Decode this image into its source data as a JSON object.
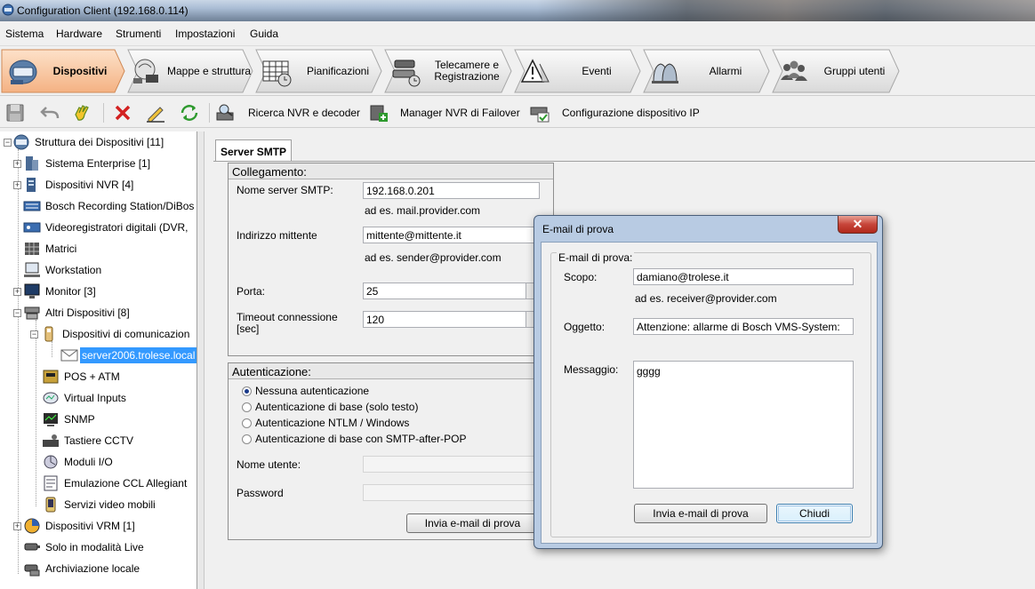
{
  "window": {
    "title": "Configuration Client (192.168.0.114)"
  },
  "menu": [
    "Sistema",
    "Hardware",
    "Strumenti",
    "Impostazioni",
    "Guida"
  ],
  "nav_tabs": [
    {
      "label": "Dispositivi",
      "icon": "devices-icon",
      "active": true
    },
    {
      "label": "Mappe e struttura",
      "icon": "maps-structure-icon",
      "active": false
    },
    {
      "label": "Pianificazioni",
      "icon": "schedules-icon",
      "active": false
    },
    {
      "label": "Telecamere e\nRegistrazione",
      "icon": "cameras-recording-icon",
      "active": false
    },
    {
      "label": "Eventi",
      "icon": "events-icon",
      "active": false
    },
    {
      "label": "Allarmi",
      "icon": "alarms-icon",
      "active": false
    },
    {
      "label": "Gruppi utenti",
      "icon": "user-groups-icon",
      "active": false
    }
  ],
  "toolbar": {
    "scan_nvr": "Ricerca NVR e decoder",
    "failover": "Manager NVR di Failover",
    "ip_config": "Configurazione dispositivo IP"
  },
  "tree": {
    "root": "Struttura dei Dispositivi [11]",
    "items": [
      "Sistema Enterprise [1]",
      "Dispositivi NVR [4]",
      "Bosch Recording Station/DiBos",
      "Videoregistratori digitali (DVR,",
      "Matrici",
      "Workstation",
      "Monitor [3]",
      "Altri Dispositivi [8]",
      "Dispositivi di comunicazion",
      "server2006.trolese.local",
      "POS + ATM",
      "Virtual Inputs",
      "SNMP",
      "Tastiere CCTV",
      "Moduli I/O",
      "Emulazione CCL Allegiant",
      "Servizi video mobili",
      "Dispositivi VRM [1]",
      "Solo in modalità Live",
      "Archiviazione locale"
    ]
  },
  "smtp": {
    "tab": "Server SMTP",
    "connection_title": "Collegamento:",
    "server_label": "Nome server SMTP:",
    "server_value": "192.168.0.201",
    "server_hint": "ad es. mail.provider.com",
    "sender_label": "Indirizzo mittente",
    "sender_value": "mittente@mittente.it",
    "sender_hint": "ad es. sender@provider.com",
    "port_label": "Porta:",
    "port_value": "25",
    "timeout_label": "Timeout connessione\n[sec]",
    "timeout_value": "120",
    "auth_title": "Autenticazione:",
    "auth_options": [
      "Nessuna autenticazione",
      "Autenticazione di base (solo testo)",
      "Autenticazione NTLM / Windows",
      "Autenticazione di base con SMTP-after-POP"
    ],
    "auth_selected": 0,
    "user_label": "Nome utente:",
    "password_label": "Password",
    "test_button": "Invia e-mail di prova"
  },
  "dialog": {
    "title": "E-mail di prova",
    "close": "✕",
    "group_label": "E-mail di prova:",
    "to_label": "Scopo:",
    "to_value": "damiano@trolese.it",
    "to_hint": "ad es. receiver@provider.com",
    "subject_label": "Oggetto:",
    "subject_value": "Attenzione: allarme di Bosch VMS-System:",
    "message_label": "Messaggio:",
    "message_value": "gggg",
    "send_button": "Invia e-mail di prova",
    "close_button": "Chiudi"
  }
}
